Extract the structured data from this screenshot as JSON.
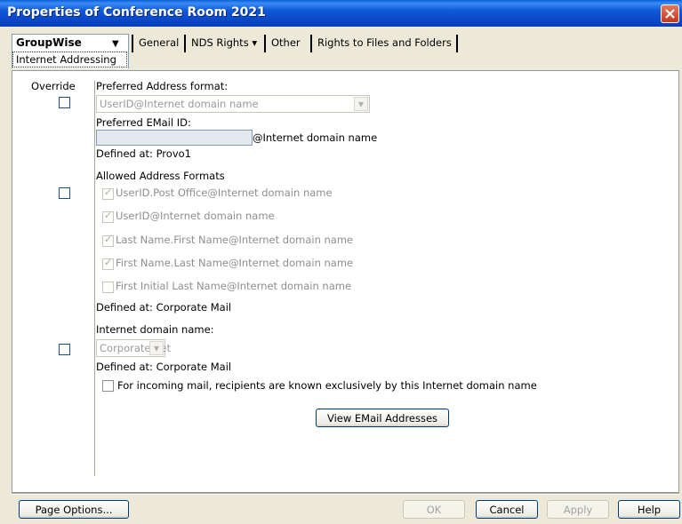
{
  "window": {
    "title": "Properties of Conference Room 2021"
  },
  "tabs": {
    "active": {
      "label": "GroupWise",
      "subtab": "Internet Addressing"
    },
    "others": [
      {
        "label": "General"
      },
      {
        "label": "NDS Rights ▾"
      },
      {
        "label": "Other"
      },
      {
        "label": "Rights to Files and Folders"
      }
    ]
  },
  "form": {
    "override_header": "Override",
    "preferred_format": {
      "label": "Preferred Address format:",
      "value": "UserID@Internet domain name"
    },
    "preferred_email": {
      "label": "Preferred EMail ID:",
      "value": "",
      "suffix": "@Internet domain name",
      "defined_at": "Defined at:  Provo1"
    },
    "allowed": {
      "label": "Allowed Address Formats",
      "options": [
        {
          "label": "UserID.Post Office@Internet domain name",
          "checked": true
        },
        {
          "label": "UserID@Internet domain name",
          "checked": true
        },
        {
          "label": "Last Name.First Name@Internet domain name",
          "checked": true
        },
        {
          "label": "First Name.Last Name@Internet domain name",
          "checked": true
        },
        {
          "label": "First Initial Last Name@Internet domain name",
          "checked": false
        }
      ],
      "defined_at": "Defined at:  Corporate Mail"
    },
    "domain": {
      "label": "Internet domain name:",
      "value": "Corporate.net",
      "defined_at": "Defined at:  Corporate Mail",
      "exclusive_label": "For incoming mail, recipients are known exclusively by this Internet domain name"
    },
    "view_button": "View EMail Addresses"
  },
  "footer": {
    "page_options": "Page Options...",
    "ok": "OK",
    "cancel": "Cancel",
    "apply": "Apply",
    "help": "Help"
  }
}
